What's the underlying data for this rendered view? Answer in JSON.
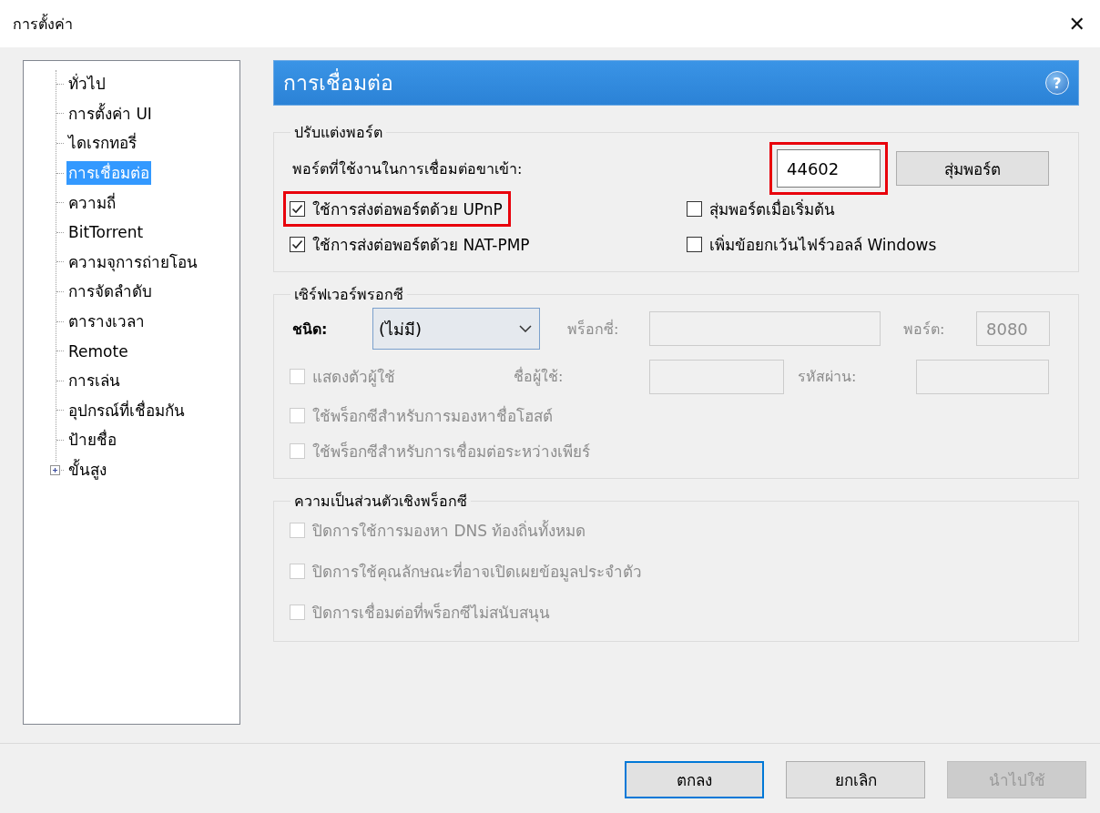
{
  "window": {
    "title": "การตั้งค่า",
    "close_icon": "✕"
  },
  "sidebar": {
    "items": [
      {
        "label": "ทั่วไป",
        "selected": false,
        "kind": "leaf"
      },
      {
        "label": "การตั้งค่า UI",
        "selected": false,
        "kind": "leaf"
      },
      {
        "label": "ไดเรกทอรี่",
        "selected": false,
        "kind": "leaf"
      },
      {
        "label": "การเชื่อมต่อ",
        "selected": true,
        "kind": "leaf"
      },
      {
        "label": "ความถี่",
        "selected": false,
        "kind": "leaf"
      },
      {
        "label": "BitTorrent",
        "selected": false,
        "kind": "leaf"
      },
      {
        "label": "ความจุการถ่ายโอน",
        "selected": false,
        "kind": "leaf"
      },
      {
        "label": "การจัดลำดับ",
        "selected": false,
        "kind": "leaf"
      },
      {
        "label": "ตารางเวลา",
        "selected": false,
        "kind": "leaf"
      },
      {
        "label": "Remote",
        "selected": false,
        "kind": "leaf"
      },
      {
        "label": "การเล่น",
        "selected": false,
        "kind": "leaf"
      },
      {
        "label": "อุปกรณ์ที่เชื่อมกัน",
        "selected": false,
        "kind": "leaf"
      },
      {
        "label": "ป้ายชื่อ",
        "selected": false,
        "kind": "leaf"
      },
      {
        "label": "ขั้นสูง",
        "selected": false,
        "kind": "branch",
        "expanded": false
      }
    ]
  },
  "page": {
    "title": "การเชื่อมต่อ",
    "help_icon": "?"
  },
  "port_group": {
    "title": "ปรับแต่งพอร์ต",
    "port_label": "พอร์ตที่ใช้งานในการเชื่อมต่อขาเข้า:",
    "port_value": "44602",
    "port_highlighted": true,
    "random_button": "สุ่มพอร์ต",
    "options": [
      {
        "label": "ใช้การส่งต่อพอร์ตด้วย UPnP",
        "checked": true,
        "highlighted": true
      },
      {
        "label": "สุ่มพอร์ตเมื่อเริ่มต้น",
        "checked": false,
        "highlighted": false
      },
      {
        "label": "ใช้การส่งต่อพอร์ตด้วย NAT-PMP",
        "checked": true,
        "highlighted": false
      },
      {
        "label": "เพิ่มข้อยกเว้นไฟร์วอลล์ Windows",
        "checked": false,
        "highlighted": false
      }
    ]
  },
  "proxy_group": {
    "title": "เซิร์ฟเวอร์พรอกซี",
    "type_label": "ชนิด:",
    "type_value": "(ไม่มี)",
    "host_label": "พร็อกซี่:",
    "port_label": "พอร์ต:",
    "port_value": "8080",
    "fields_disabled": true,
    "auth": {
      "label": "แสดงตัวผู้ใช้",
      "checked": false,
      "disabled": true
    },
    "username_label": "ชื่อผู้ใช้:",
    "password_label": "รหัสผ่าน:",
    "options": [
      {
        "label": "ใช้พร็อกซีสำหรับการมองหาชื่อโฮสต์",
        "checked": false,
        "disabled": true
      },
      {
        "label": "ใช้พร็อกซีสำหรับการเชื่อมต่อระหว่างเพียร์",
        "checked": false,
        "disabled": true
      }
    ]
  },
  "privacy_group": {
    "title": "ความเป็นส่วนตัวเชิงพร็อกซี",
    "options": [
      {
        "label": "ปิดการใช้การมองหา DNS ท้องถิ่นทั้งหมด",
        "checked": false,
        "disabled": true
      },
      {
        "label": "ปิดการใช้คุณลักษณะที่อาจเปิดเผยข้อมูลประจำตัว",
        "checked": false,
        "disabled": true
      },
      {
        "label": "ปิดการเชื่อมต่อที่พร็อกซีไม่สนับสนุน",
        "checked": false,
        "disabled": true
      }
    ]
  },
  "buttons": [
    {
      "label": "ตกลง",
      "default": true,
      "disabled": false
    },
    {
      "label": "ยกเลิก",
      "default": false,
      "disabled": false
    },
    {
      "label": "นำไปใช้",
      "default": false,
      "disabled": true
    }
  ]
}
